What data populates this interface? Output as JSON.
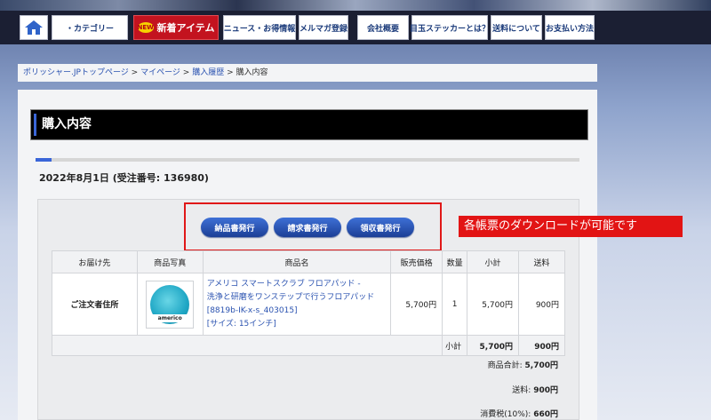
{
  "nav": {
    "category": "・カテゴリー",
    "new_badge": "NEW",
    "new_items": "新着アイテム",
    "news": "ニュース・お得情報",
    "mailmag": "メルマガ登録",
    "company": "会社概要",
    "sticker": "目玉ステッカーとは？",
    "shipping": "送料について",
    "payment": "お支払い方法"
  },
  "breadcrumb": {
    "top": "ポリッシャー.JPトップページ",
    "sep": ">",
    "mypage": "マイページ",
    "history": "購入履歴",
    "current": "購入内容"
  },
  "page_title": "購入内容",
  "order_heading": "2022年8月1日 (受注番号: 136980)",
  "buttons": {
    "delivery_note": "納品書発行",
    "invoice": "請求書発行",
    "receipt": "領収書発行"
  },
  "callout": "各帳票のダウンロードが可能です",
  "table": {
    "headers": [
      "お届け先",
      "商品写真",
      "商品名",
      "販売価格",
      "数量",
      "小計",
      "送料"
    ],
    "row": {
      "destination": "ご注文者住所",
      "thumb_logo": "americo",
      "name_line1": "アメリコ スマートスクラブ フロアパッド -",
      "name_line2": "洗浄と研磨をワンステップで行うフロアパッド",
      "name_line3": "[8819b-IK-x-s_403015]",
      "name_line4": "[サイズ: 15インチ]",
      "price": "5,700円",
      "qty": "1",
      "subtotal": "5,700円",
      "shipping": "900円"
    },
    "sum_label": "小計",
    "sum_subtotal": "5,700円",
    "sum_shipping": "900円"
  },
  "totals": {
    "goods_label": "商品合計:",
    "goods_value": "5,700円",
    "shipping_label": "送料:",
    "shipping_value": "900円",
    "tax_label": "消費税(10%):",
    "tax_value": "660円"
  },
  "colors": {
    "nav_bg": "#1b1f33",
    "accent_blue": "#3a66d8",
    "highlight_red": "#e01818",
    "new_red": "#c3131f"
  },
  "progress_fraction": 0.03
}
